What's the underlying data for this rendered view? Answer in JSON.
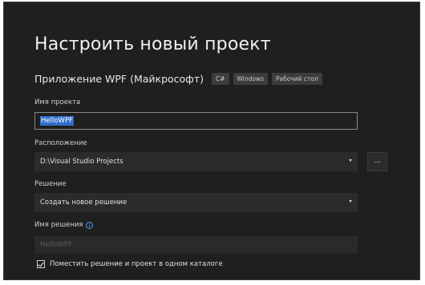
{
  "dialog": {
    "title": "Настроить новый проект",
    "template_name": "Приложение WPF (Майкрософт)",
    "tags": [
      "C#",
      "Windows",
      "Рабочий стол"
    ]
  },
  "project_name": {
    "label": "Имя проекта",
    "value": "HelloWPF"
  },
  "location": {
    "label": "Расположение",
    "value": "D:\\Visual Studio Projects",
    "browse_label": "..."
  },
  "solution": {
    "label": "Решение",
    "value": "Создать новое решение"
  },
  "solution_name": {
    "label": "Имя решения",
    "value": "HelloWPF"
  },
  "same_directory": {
    "label": "Поместить решение и проект в одном каталоге",
    "checked": true
  }
}
